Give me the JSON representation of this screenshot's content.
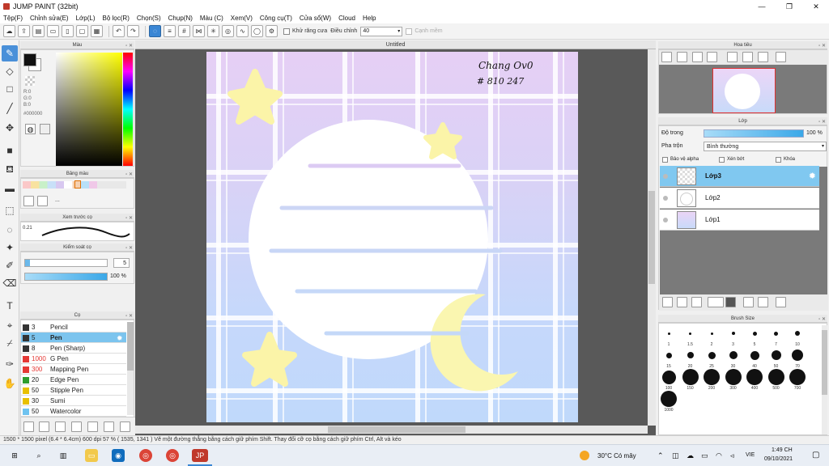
{
  "window": {
    "title": "JUMP PAINT (32bit)",
    "controls": [
      "—",
      "❐",
      "✕"
    ]
  },
  "menu": [
    "Tệp(F)",
    "Chỉnh sửa(E)",
    "Lớp(L)",
    "Bộ lọc(R)",
    "Chọn(S)",
    "Chụp(N)",
    "Màu (C)",
    "Xem(V)",
    "Công cụ(T)",
    "Cửa sổ(W)",
    "Cloud",
    "Help"
  ],
  "toolbar": {
    "antialias_label": "Khử răng cưa",
    "adjust_label": "Điều chỉnh",
    "adjust_value": "40",
    "snap_label": "Cạnh mềm"
  },
  "color_panel": {
    "title": "Màu",
    "r": "R:0",
    "g": "G:0",
    "b": "B:0",
    "hex": "#000000"
  },
  "palette_panel": {
    "title": "Bảng màu",
    "more": "..."
  },
  "preview_panel": {
    "title": "Xem trước cọ",
    "value": "0.21"
  },
  "brush_control": {
    "title": "Kiểm soát cọ",
    "size_value": "5",
    "opacity_value": "100 %"
  },
  "brush_list": {
    "title": "Cọ",
    "items": [
      {
        "size": "3",
        "name": "Pencil",
        "color": "#333333"
      },
      {
        "size": "5",
        "name": "Pen",
        "color": "#333333"
      },
      {
        "size": "8",
        "name": "Pen (Sharp)",
        "color": "#333333"
      },
      {
        "size": "1000",
        "name": "G Pen",
        "color": "#e53935"
      },
      {
        "size": "300",
        "name": "Mapping Pen",
        "color": "#e53935"
      },
      {
        "size": "20",
        "name": "Edge Pen",
        "color": "#2e9d2e"
      },
      {
        "size": "50",
        "name": "Stipple Pen",
        "color": "#e8c000"
      },
      {
        "size": "30",
        "name": "Sumi",
        "color": "#e8c000"
      },
      {
        "size": "50",
        "name": "Watercolor",
        "color": "#6fc3f0"
      }
    ]
  },
  "document": {
    "tab_title": "Untitled",
    "handwriting_line1": "Chang Ov0",
    "handwriting_line2": "# 810 247"
  },
  "navigator": {
    "title": "Hoa tiêu"
  },
  "layers_panel": {
    "title": "Lớp",
    "opacity_label": "Độ trong",
    "opacity_value": "100 %",
    "blend_label": "Pha trộn",
    "blend_value": "Bình thường",
    "protect_alpha": "Bảo vệ alpha",
    "clipping": "Xén bớt",
    "lock": "Khóa",
    "layers": [
      {
        "name": "Lớp3",
        "selected": true
      },
      {
        "name": "Lớp2",
        "selected": false
      },
      {
        "name": "Lớp1",
        "selected": false
      }
    ]
  },
  "brush_size_panel": {
    "title": "Brush Size",
    "sizes": [
      "1",
      "1.5",
      "2",
      "3",
      "5",
      "7",
      "10",
      "15",
      "20",
      "25",
      "30",
      "40",
      "50",
      "70",
      "100",
      "150",
      "200",
      "300",
      "400",
      "500",
      "700",
      "1000"
    ]
  },
  "statusbar": {
    "text": "1500 * 1500 pixel    (6.4 * 6.4cm)    600 dpi    57 %    ( 1535, 1341 )    Vẽ một đường thẳng bằng cách giữ phím Shift. Thay đổi cỡ cọ bằng cách giữ phím Ctrl, Alt và kéo"
  },
  "taskbar": {
    "weather": "30°C  Có mây",
    "lang": "VIE",
    "time": "1:49 CH",
    "date": "09/10/2021"
  },
  "colors": {
    "accent": "#4a90d9",
    "selected_row": "#80c8f0",
    "star": "#fbf4a8",
    "lines": "#c9d6f3"
  }
}
